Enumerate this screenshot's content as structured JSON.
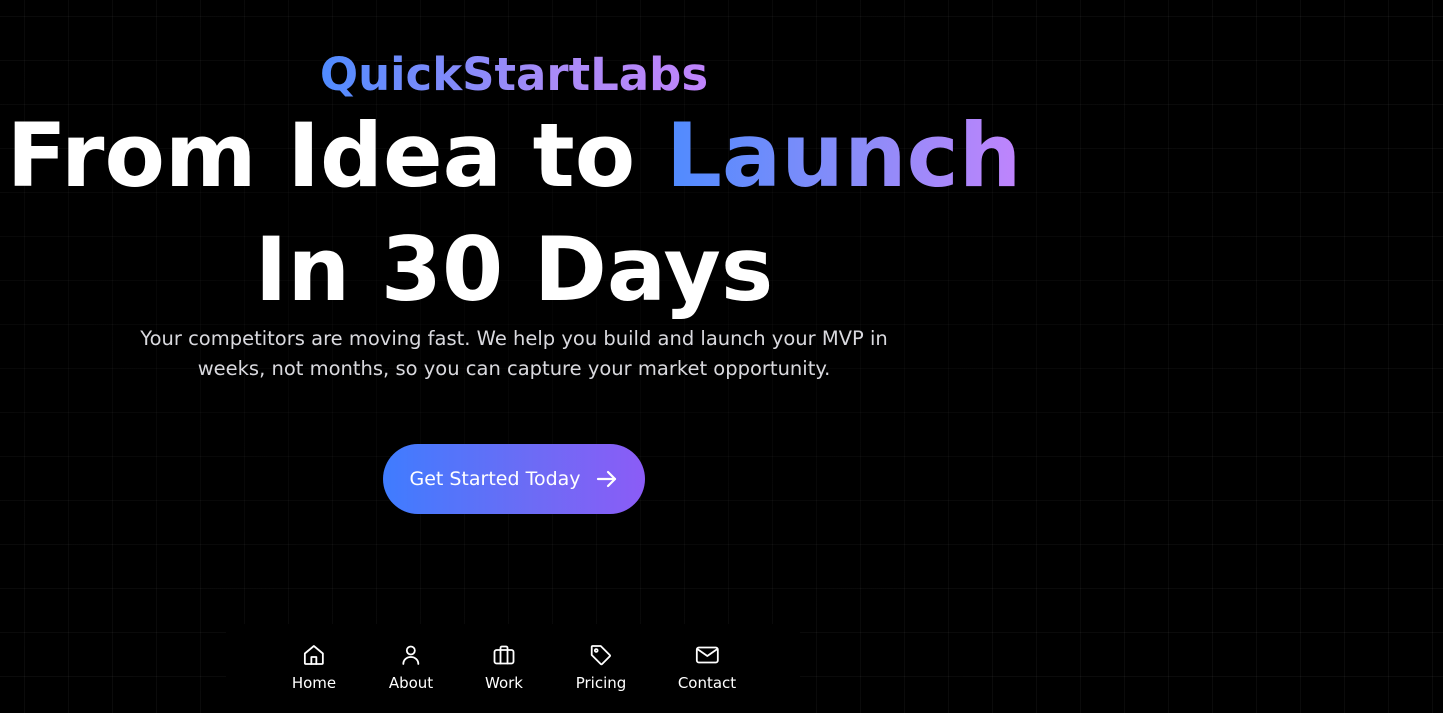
{
  "brand": {
    "name": "QuickStartLabs"
  },
  "hero": {
    "headline_line1_prefix": "From Idea to ",
    "headline_line1_accent": "Launch",
    "headline_line2": "In 30 Days",
    "subtitle_line1": "Your competitors are moving fast. We help you build and launch your MVP in",
    "subtitle_line2": "weeks, not months, so you can capture your market opportunity.",
    "cta_label": "Get Started Today",
    "cta_icon": "arrow-right-icon"
  },
  "nav": {
    "items": [
      {
        "label": "Home",
        "icon": "home-icon"
      },
      {
        "label": "About",
        "icon": "user-icon"
      },
      {
        "label": "Work",
        "icon": "briefcase-icon"
      },
      {
        "label": "Pricing",
        "icon": "tag-icon"
      },
      {
        "label": "Contact",
        "icon": "mail-icon"
      }
    ]
  },
  "colors": {
    "background": "#000000",
    "gradient_start": "#4f8bff",
    "gradient_end": "#c084fc",
    "text": "#ffffff",
    "subtitle_text": "#d9d9de"
  }
}
